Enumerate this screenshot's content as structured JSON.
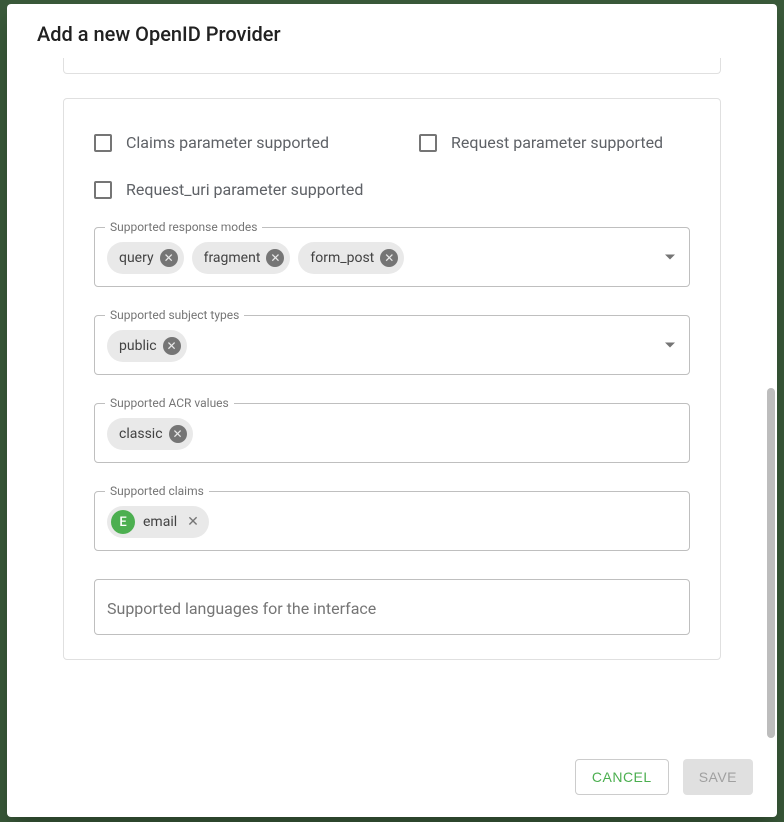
{
  "dialog": {
    "title": "Add a new OpenID Provider",
    "checkboxes": {
      "claims_supported": "Claims parameter supported",
      "request_supported": "Request parameter supported",
      "request_uri_supported": "Request_uri parameter supported"
    },
    "fields": {
      "response_modes": {
        "label": "Supported response modes",
        "chips": [
          "query",
          "fragment",
          "form_post"
        ]
      },
      "subject_types": {
        "label": "Supported subject types",
        "chips": [
          "public"
        ]
      },
      "acr_values": {
        "label": "Supported ACR values",
        "chips": [
          "classic"
        ]
      },
      "claims": {
        "label": "Supported claims",
        "avatar": "E",
        "chip": "email"
      },
      "languages": {
        "placeholder": "Supported languages for the interface"
      }
    },
    "actions": {
      "cancel": "Cancel",
      "save": "Save"
    }
  }
}
